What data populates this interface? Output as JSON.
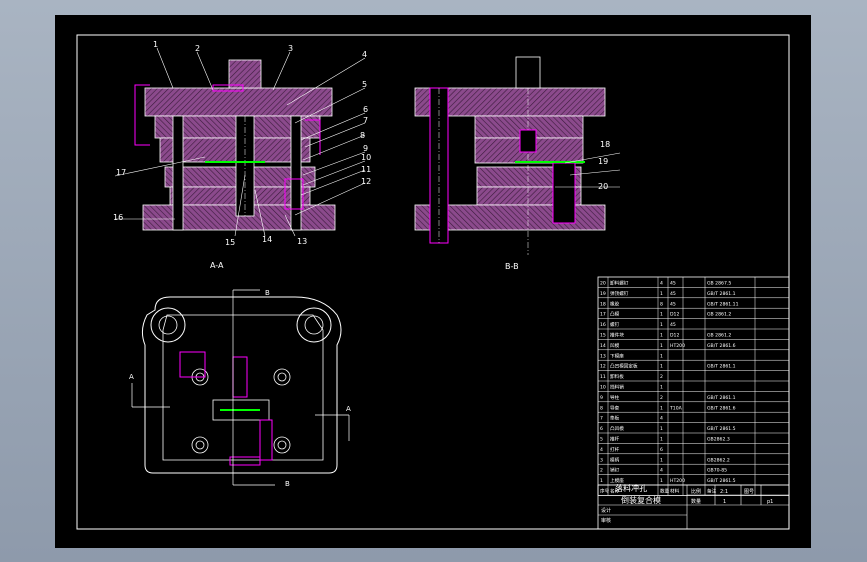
{
  "colors": {
    "background_app": "#97a3b3",
    "drawing_bg": "#000000",
    "line": "#ffffff",
    "hatch": "#8b4a8c",
    "accent": "#ff00ff",
    "highlight": "#00ff00"
  },
  "part_labels": [
    "1",
    "2",
    "3",
    "4",
    "5",
    "6",
    "7",
    "8",
    "9",
    "10",
    "11",
    "12",
    "13",
    "14",
    "15",
    "16",
    "17",
    "18",
    "19",
    "20"
  ],
  "views": {
    "section_aa": "A-A",
    "section_bb": "B-B",
    "mark_a": "A",
    "mark_b": "B"
  },
  "bom": {
    "rows": [
      {
        "no": "20",
        "name": "卸料螺钉",
        "qty": "4",
        "mat": "45",
        "note": "GB 2867.5"
      },
      {
        "no": "19",
        "name": "弹顶螺钉",
        "qty": "1",
        "mat": "45",
        "note": "GB/T 2861.1"
      },
      {
        "no": "18",
        "name": "橡胶",
        "qty": "8",
        "mat": "45",
        "note": "GB/T 2861.11"
      },
      {
        "no": "17",
        "name": "凸模",
        "qty": "1",
        "mat": "D12",
        "note": "GB 2861.2"
      },
      {
        "no": "16",
        "name": "螺钉",
        "qty": "1",
        "mat": "45",
        "note": ""
      },
      {
        "no": "15",
        "name": "推件块",
        "qty": "1",
        "mat": "D12",
        "note": "GB 2861.2"
      },
      {
        "no": "14",
        "name": "凹模",
        "qty": "1",
        "mat": "HT200",
        "note": "GB/T 2861.6"
      },
      {
        "no": "13",
        "name": "下模座",
        "qty": "1",
        "mat": "",
        "note": ""
      },
      {
        "no": "12",
        "name": "凸凹模固定板",
        "qty": "1",
        "mat": "",
        "note": "GB/T 2861.1"
      },
      {
        "no": "11",
        "name": "卸料板",
        "qty": "2",
        "mat": "",
        "note": ""
      },
      {
        "no": "10",
        "name": "挡料销",
        "qty": "1",
        "mat": "",
        "note": ""
      },
      {
        "no": "9",
        "name": "导柱",
        "qty": "2",
        "mat": "",
        "note": "GB/T 2861.1"
      },
      {
        "no": "8",
        "name": "导套",
        "qty": "1",
        "mat": "T10A",
        "note": "GB/T 2861.6"
      },
      {
        "no": "7",
        "name": "垫板",
        "qty": "4",
        "mat": "",
        "note": ""
      },
      {
        "no": "6",
        "name": "凸凹模",
        "qty": "1",
        "mat": "",
        "note": "GB/T 2861.5"
      },
      {
        "no": "5",
        "name": "推杆",
        "qty": "1",
        "mat": "",
        "note": "GB2862.3"
      },
      {
        "no": "4",
        "name": "打杆",
        "qty": "6",
        "mat": "",
        "note": ""
      },
      {
        "no": "3",
        "name": "模柄",
        "qty": "1",
        "mat": "",
        "note": "GB2862.2"
      },
      {
        "no": "2",
        "name": "销钉",
        "qty": "4",
        "mat": "",
        "note": "GB70-85"
      },
      {
        "no": "1",
        "name": "上模座",
        "qty": "1",
        "mat": "HT200",
        "note": "GB/T 2861.5"
      }
    ],
    "header": {
      "no": "序号",
      "name": "名称",
      "qty": "数量",
      "mat": "材料",
      "note": "备注"
    },
    "title_line1": "落料冲孔",
    "title_line2": "倒装复合模",
    "scale_label": "比例",
    "scale_value": "2:1",
    "qty_label": "数量",
    "qty_value": "1",
    "sheet_label": "图号",
    "sheet_value": "p1",
    "designer_label": "设计",
    "checker_label": "审核"
  }
}
